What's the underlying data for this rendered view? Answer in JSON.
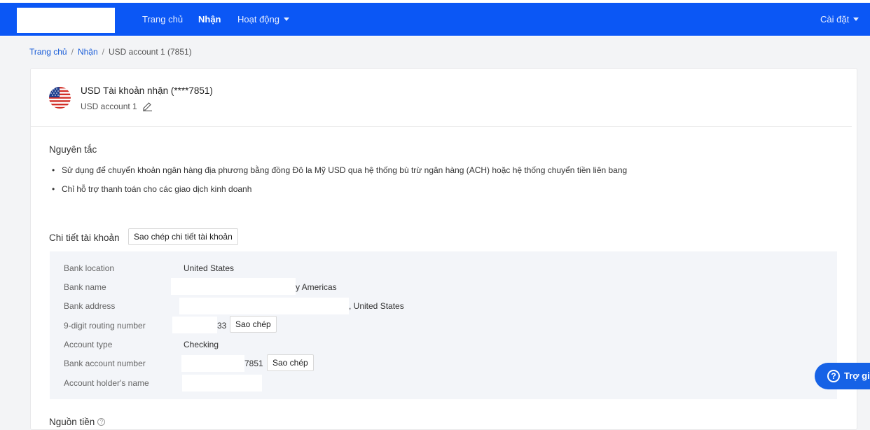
{
  "nav": {
    "items": [
      "Trang chủ",
      "Nhận",
      "Hoạt động"
    ],
    "settings": "Cài đặt"
  },
  "breadcrumb": {
    "home": "Trang chủ",
    "receive": "Nhận",
    "current": "USD account 1 (7851)"
  },
  "account": {
    "title": "USD Tài khoản nhận (****7851)",
    "subtitle": "USD account 1"
  },
  "principles": {
    "title": "Nguyên tắc",
    "items": [
      "Sử dụng để chuyển khoản ngân hàng địa phương bằng đồng Đô la Mỹ USD qua hệ thống bù trừ ngân hàng (ACH) hoặc hệ thống chuyển tiền liên bang",
      "Chỉ hỗ trợ thanh toán cho các giao dịch kinh doanh"
    ]
  },
  "details": {
    "title": "Chi tiết tài khoản",
    "copy_all": "Sao chép chi tiết tài khoản",
    "copy": "Sao chép",
    "rows": [
      {
        "label": "Bank location",
        "value": "United States"
      },
      {
        "label": "Bank name",
        "value": "y Americas"
      },
      {
        "label": "Bank address",
        "value": ",  United States"
      },
      {
        "label": "9-digit routing number",
        "value": "33"
      },
      {
        "label": "Account type",
        "value": "Checking"
      },
      {
        "label": "Bank account number",
        "value": "7851"
      },
      {
        "label": "Account holder's name",
        "value": ""
      }
    ]
  },
  "source": {
    "title": "Nguồn tiền"
  },
  "help": {
    "label": "Trợ gi"
  },
  "colors": {
    "nav": "#0b57f5",
    "link": "#1a5dd8",
    "help": "#1662e6"
  }
}
